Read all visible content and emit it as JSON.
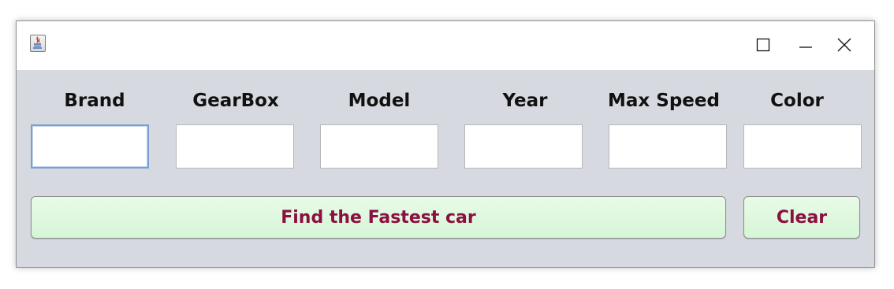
{
  "window": {
    "icon": "java-app-icon",
    "controls": {
      "minimize": "minimize-icon",
      "maximize": "maximize-icon",
      "close": "close-icon"
    }
  },
  "form": {
    "fields": [
      {
        "label": "Brand",
        "value": ""
      },
      {
        "label": "GearBox",
        "value": ""
      },
      {
        "label": "Model",
        "value": ""
      },
      {
        "label": "Year",
        "value": ""
      },
      {
        "label": "Max Speed",
        "value": ""
      },
      {
        "label": "Color",
        "value": ""
      }
    ]
  },
  "buttons": {
    "find_label": "Find the Fastest car",
    "clear_label": "Clear"
  },
  "colors": {
    "window_bg": "#d6d9e0",
    "button_bg": "#d6f5d6",
    "button_text": "#8b1040",
    "focus_border": "#7b9fd1"
  }
}
